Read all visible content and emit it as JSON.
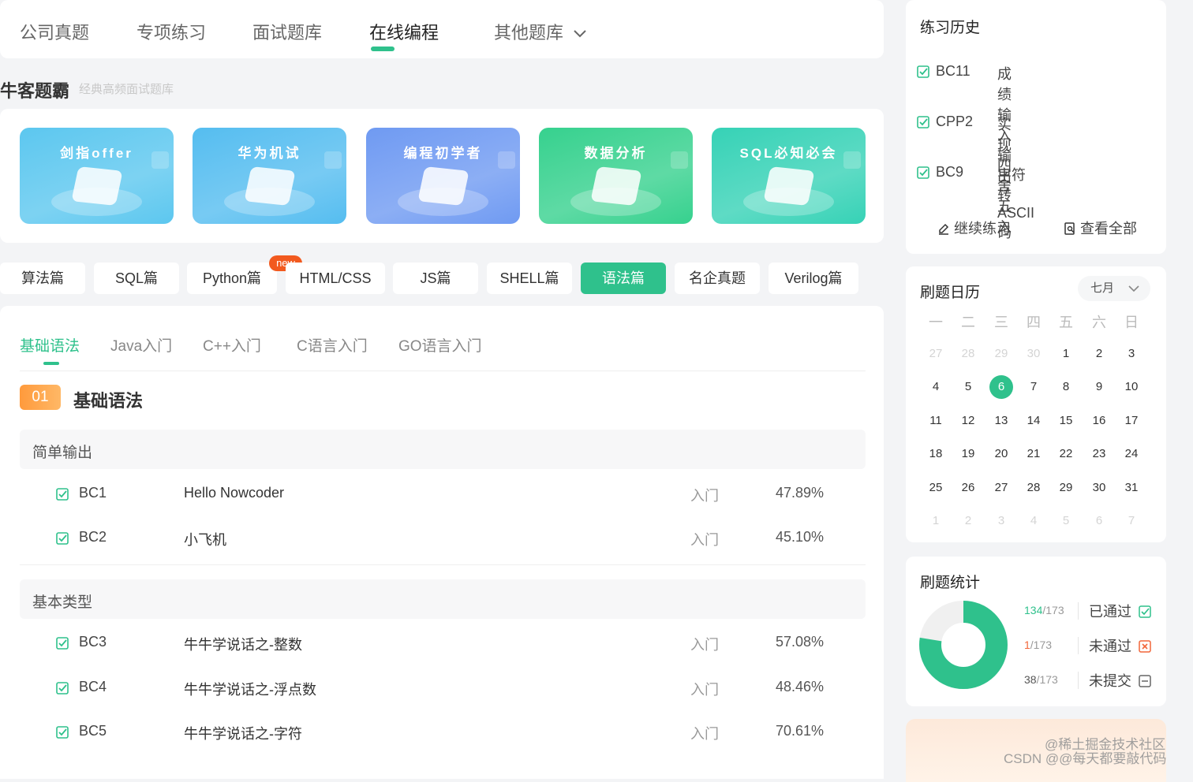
{
  "nav": {
    "items": [
      "公司真题",
      "专项练习",
      "面试题库",
      "在线编程",
      "其他题库"
    ],
    "active": "在线编程"
  },
  "brand": {
    "title": "牛客题霸",
    "subtitle": "经典高频面试题库"
  },
  "banners": [
    {
      "label": "剑指offer",
      "color": "#5cc7ef"
    },
    {
      "label": "华为机试",
      "color": "#55bdf0"
    },
    {
      "label": "编程初学者",
      "color": "#6f9af2"
    },
    {
      "label": "数据分析",
      "color": "#36d18e"
    },
    {
      "label": "SQL必知必会",
      "color": "#36d2b6"
    }
  ],
  "categories": {
    "items": [
      "算法篇",
      "SQL篇",
      "Python篇",
      "HTML/CSS",
      "JS篇",
      "SHELL篇",
      "语法篇",
      "名企真题",
      "Verilog篇"
    ],
    "active": "语法篇",
    "new_badge": "new"
  },
  "subtabs": {
    "items": [
      "基础语法",
      "Java入门",
      "C++入门",
      "C语言入门",
      "GO语言入门"
    ],
    "active": "基础语法"
  },
  "section": {
    "number": "01",
    "title": "基础语法"
  },
  "groups": [
    {
      "name": "简单输出",
      "rows": [
        {
          "id": "BC1",
          "title": "Hello Nowcoder",
          "level": "入门",
          "rate": "47.89%"
        },
        {
          "id": "BC2",
          "title": "小飞机",
          "level": "入门",
          "rate": "45.10%"
        }
      ]
    },
    {
      "name": "基本类型",
      "rows": [
        {
          "id": "BC3",
          "title": "牛牛学说话之-整数",
          "level": "入门",
          "rate": "57.08%"
        },
        {
          "id": "BC4",
          "title": "牛牛学说话之-浮点数",
          "level": "入门",
          "rate": "48.46%"
        },
        {
          "id": "BC5",
          "title": "牛牛学说话之-字符",
          "level": "入门",
          "rate": "70.61%"
        }
      ]
    }
  ],
  "history": {
    "title": "练习历史",
    "items": [
      {
        "id": "BC11",
        "title": "成绩输入输出"
      },
      {
        "id": "CPP2",
        "title": "实现四舍五入"
      },
      {
        "id": "BC9",
        "title": "字符转ASCII码"
      }
    ],
    "continue_label": "继续练习",
    "view_all_label": "查看全部"
  },
  "calendar": {
    "title": "刷题日历",
    "month": "七月",
    "weekdays": [
      "一",
      "二",
      "三",
      "四",
      "五",
      "六",
      "日"
    ],
    "today": "6",
    "weeks": [
      [
        "27",
        "28",
        "29",
        "30",
        "1",
        "2",
        "3"
      ],
      [
        "4",
        "5",
        "6",
        "7",
        "8",
        "9",
        "10"
      ],
      [
        "11",
        "12",
        "13",
        "14",
        "15",
        "16",
        "17"
      ],
      [
        "18",
        "19",
        "20",
        "21",
        "22",
        "23",
        "24"
      ],
      [
        "25",
        "26",
        "27",
        "28",
        "29",
        "30",
        "31"
      ],
      [
        "1",
        "2",
        "3",
        "4",
        "5",
        "6",
        "7"
      ]
    ]
  },
  "stats": {
    "title": "刷题统计",
    "passed": {
      "count": "134",
      "total": "/173",
      "label": "已通过",
      "color": "#2fc18c"
    },
    "failed": {
      "count": "1",
      "total": "/173",
      "label": "未通过",
      "color": "#f2663a"
    },
    "unsubmitted": {
      "count": "38",
      "total": "/173",
      "label": "未提交",
      "color": "#555555"
    },
    "ring_fraction_passed": 0.775
  },
  "watermark": {
    "line1": "@稀土掘金技术社区",
    "line2": "CSDN @@每天都要敲代码"
  },
  "colors": {
    "accent": "#2fc18c",
    "orange": "#ff9a3c",
    "danger": "#f2663a"
  }
}
